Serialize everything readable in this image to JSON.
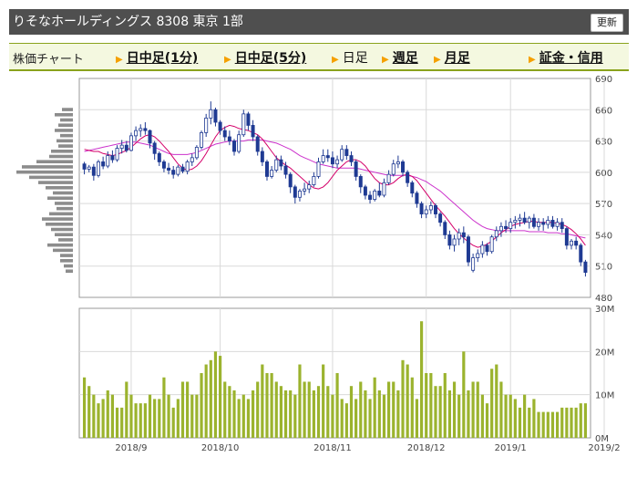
{
  "header": {
    "title": "りそなホールディングス 8308 東京 1部",
    "refresh_label": "更新"
  },
  "tabs": {
    "chart_label": "株価チャート",
    "items": [
      {
        "label": "日中足(1分)",
        "style": "bold"
      },
      {
        "label": "日中足(5分)",
        "style": "bold"
      },
      {
        "label": "日足",
        "style": "plain"
      },
      {
        "label": "週足",
        "style": "bold"
      },
      {
        "label": "月足",
        "style": "bold"
      },
      {
        "label": "証金・信用",
        "style": "bold"
      }
    ]
  },
  "colors": {
    "accent": "#8aa21c",
    "up": "#ffffff",
    "down": "#1f3a93",
    "ma_short": "#d4006a",
    "ma_long": "#cc33cc",
    "volume": "#9bb32e",
    "profile": "#8c8c8c"
  },
  "chart_data": {
    "type": "candlestick",
    "title": "",
    "price_axis": {
      "ylim": [
        480,
        690
      ],
      "ticks": [
        480,
        510,
        540,
        570,
        600,
        630,
        660,
        690
      ]
    },
    "volume_axis": {
      "ylim": [
        0,
        30
      ],
      "ticks": [
        "0M",
        "10M",
        "20M",
        "30M"
      ]
    },
    "x_labels": [
      "2018/9",
      "2018/10",
      "2018/11",
      "2018/12",
      "2019/1",
      "2019/2"
    ],
    "x_label_index": [
      10,
      29,
      53,
      73,
      91,
      111
    ],
    "grid": true,
    "candles": [
      [
        608,
        610,
        598,
        603
      ],
      [
        603,
        607,
        600,
        605
      ],
      [
        605,
        608,
        592,
        597
      ],
      [
        597,
        612,
        595,
        610
      ],
      [
        610,
        615,
        603,
        606
      ],
      [
        606,
        620,
        604,
        616
      ],
      [
        616,
        621,
        609,
        612
      ],
      [
        612,
        626,
        610,
        623
      ],
      [
        623,
        631,
        618,
        626
      ],
      [
        626,
        630,
        619,
        621
      ],
      [
        621,
        638,
        620,
        635
      ],
      [
        635,
        644,
        630,
        640
      ],
      [
        640,
        646,
        634,
        642
      ],
      [
        642,
        648,
        636,
        640
      ],
      [
        640,
        641,
        623,
        628
      ],
      [
        628,
        630,
        612,
        618
      ],
      [
        618,
        620,
        606,
        610
      ],
      [
        610,
        612,
        600,
        604
      ],
      [
        604,
        609,
        598,
        602
      ],
      [
        602,
        606,
        594,
        598
      ],
      [
        598,
        607,
        596,
        605
      ],
      [
        605,
        608,
        599,
        601
      ],
      [
        601,
        612,
        598,
        610
      ],
      [
        610,
        618,
        606,
        614
      ],
      [
        614,
        626,
        612,
        624
      ],
      [
        624,
        640,
        622,
        638
      ],
      [
        638,
        656,
        634,
        652
      ],
      [
        652,
        668,
        646,
        660
      ],
      [
        660,
        662,
        644,
        648
      ],
      [
        648,
        650,
        636,
        640
      ],
      [
        640,
        644,
        630,
        634
      ],
      [
        634,
        640,
        626,
        630
      ],
      [
        630,
        632,
        616,
        620
      ],
      [
        620,
        640,
        618,
        636
      ],
      [
        636,
        660,
        634,
        656
      ],
      [
        656,
        658,
        640,
        645
      ],
      [
        645,
        650,
        630,
        634
      ],
      [
        634,
        636,
        616,
        620
      ],
      [
        620,
        624,
        606,
        610
      ],
      [
        610,
        612,
        592,
        596
      ],
      [
        596,
        606,
        594,
        602
      ],
      [
        602,
        616,
        600,
        612
      ],
      [
        612,
        616,
        602,
        606
      ],
      [
        606,
        610,
        594,
        598
      ],
      [
        598,
        600,
        580,
        586
      ],
      [
        586,
        588,
        570,
        576
      ],
      [
        576,
        584,
        572,
        582
      ],
      [
        582,
        590,
        578,
        584
      ],
      [
        584,
        592,
        580,
        588
      ],
      [
        588,
        600,
        586,
        596
      ],
      [
        596,
        614,
        594,
        610
      ],
      [
        610,
        622,
        608,
        616
      ],
      [
        616,
        622,
        610,
        614
      ],
      [
        614,
        620,
        604,
        608
      ],
      [
        608,
        616,
        604,
        612
      ],
      [
        612,
        626,
        610,
        622
      ],
      [
        622,
        626,
        612,
        616
      ],
      [
        616,
        620,
        606,
        610
      ],
      [
        610,
        612,
        592,
        596
      ],
      [
        596,
        598,
        580,
        586
      ],
      [
        586,
        588,
        574,
        578
      ],
      [
        578,
        582,
        570,
        574
      ],
      [
        574,
        584,
        572,
        582
      ],
      [
        582,
        590,
        576,
        578
      ],
      [
        578,
        594,
        576,
        590
      ],
      [
        590,
        602,
        588,
        598
      ],
      [
        598,
        612,
        596,
        608
      ],
      [
        608,
        616,
        604,
        610
      ],
      [
        610,
        612,
        596,
        600
      ],
      [
        600,
        602,
        586,
        590
      ],
      [
        590,
        592,
        576,
        580
      ],
      [
        580,
        582,
        566,
        570
      ],
      [
        570,
        572,
        556,
        560
      ],
      [
        560,
        568,
        556,
        564
      ],
      [
        564,
        572,
        560,
        568
      ],
      [
        568,
        570,
        556,
        560
      ],
      [
        560,
        562,
        548,
        552
      ],
      [
        552,
        554,
        536,
        540
      ],
      [
        540,
        544,
        526,
        530
      ],
      [
        530,
        540,
        524,
        536
      ],
      [
        536,
        546,
        530,
        542
      ],
      [
        542,
        548,
        532,
        538
      ],
      [
        538,
        540,
        510,
        514
      ],
      [
        506,
        522,
        504,
        518
      ],
      [
        518,
        526,
        514,
        522
      ],
      [
        522,
        534,
        518,
        530
      ],
      [
        530,
        532,
        520,
        524
      ],
      [
        524,
        540,
        522,
        538
      ],
      [
        538,
        548,
        534,
        544
      ],
      [
        544,
        552,
        538,
        548
      ],
      [
        548,
        554,
        542,
        546
      ],
      [
        546,
        556,
        542,
        552
      ],
      [
        552,
        558,
        546,
        554
      ],
      [
        554,
        560,
        548,
        556
      ],
      [
        556,
        562,
        550,
        552
      ],
      [
        552,
        558,
        546,
        556
      ],
      [
        556,
        560,
        546,
        548
      ],
      [
        548,
        556,
        544,
        552
      ],
      [
        552,
        556,
        544,
        550
      ],
      [
        550,
        558,
        546,
        554
      ],
      [
        554,
        558,
        546,
        548
      ],
      [
        548,
        556,
        544,
        552
      ],
      [
        552,
        556,
        542,
        546
      ],
      [
        546,
        548,
        526,
        530
      ],
      [
        530,
        536,
        526,
        534
      ],
      [
        534,
        538,
        526,
        530
      ],
      [
        530,
        532,
        510,
        514
      ],
      [
        514,
        516,
        500,
        504
      ]
    ],
    "ma_short": [
      622,
      621,
      620,
      620,
      618,
      617,
      616,
      617,
      619,
      621,
      624,
      628,
      632,
      635,
      636,
      634,
      630,
      625,
      620,
      614,
      608,
      604,
      602,
      603,
      606,
      611,
      618,
      626,
      634,
      640,
      643,
      645,
      644,
      642,
      641,
      640,
      638,
      636,
      632,
      626,
      620,
      614,
      610,
      607,
      604,
      600,
      596,
      592,
      588,
      585,
      584,
      586,
      590,
      596,
      602,
      606,
      610,
      612,
      612,
      610,
      606,
      600,
      594,
      590,
      588,
      588,
      590,
      594,
      597,
      598,
      596,
      592,
      586,
      580,
      574,
      568,
      563,
      558,
      552,
      546,
      541,
      537,
      533,
      530,
      528,
      529,
      531,
      534,
      538,
      542,
      545,
      548,
      550,
      551,
      552,
      553,
      553,
      552,
      552,
      552,
      552,
      551,
      550,
      548,
      545,
      541,
      536,
      530
    ],
    "ma_long": [
      620,
      621,
      622,
      623,
      624,
      625,
      626,
      627,
      628,
      629,
      629,
      629,
      628,
      627,
      626,
      624,
      622,
      620,
      618,
      617,
      617,
      617,
      617,
      618,
      619,
      621,
      623,
      625,
      627,
      628,
      629,
      630,
      630,
      630,
      630,
      631,
      631,
      631,
      631,
      630,
      629,
      628,
      626,
      624,
      622,
      619,
      616,
      614,
      612,
      610,
      608,
      607,
      606,
      605,
      604,
      604,
      604,
      604,
      604,
      603,
      602,
      601,
      600,
      599,
      598,
      597,
      597,
      597,
      597,
      597,
      596,
      595,
      593,
      591,
      588,
      585,
      582,
      578,
      574,
      570,
      566,
      562,
      558,
      554,
      551,
      548,
      546,
      545,
      544,
      544,
      544,
      544,
      544,
      544,
      544,
      543,
      543,
      543,
      543,
      542,
      542,
      542,
      541,
      541,
      540,
      539,
      538,
      537
    ],
    "volume": [
      14,
      12,
      10,
      8,
      9,
      11,
      10,
      7,
      7,
      13,
      10,
      8,
      8,
      8,
      10,
      9,
      9,
      14,
      10,
      7,
      9,
      13,
      13,
      10,
      10,
      15,
      17,
      18,
      20,
      19,
      13,
      12,
      11,
      9,
      10,
      9,
      11,
      13,
      17,
      15,
      15,
      13,
      12,
      11,
      11,
      10,
      17,
      13,
      13,
      11,
      12,
      17,
      12,
      10,
      15,
      9,
      8,
      12,
      9,
      13,
      11,
      9,
      14,
      11,
      10,
      13,
      13,
      11,
      18,
      17,
      14,
      9,
      27,
      15,
      15,
      12,
      12,
      15,
      11,
      13,
      10,
      20,
      11,
      13,
      13,
      10,
      8,
      16,
      17,
      13,
      10,
      10,
      9,
      7,
      10,
      7,
      9,
      6,
      6,
      6,
      6,
      6,
      7,
      7,
      7,
      7,
      8,
      8
    ],
    "volume_profile": [
      [
        660,
        12
      ],
      [
        655,
        20
      ],
      [
        650,
        14
      ],
      [
        645,
        16
      ],
      [
        640,
        20
      ],
      [
        635,
        14
      ],
      [
        630,
        18
      ],
      [
        625,
        16
      ],
      [
        620,
        24
      ],
      [
        615,
        26
      ],
      [
        610,
        40
      ],
      [
        605,
        56
      ],
      [
        600,
        62
      ],
      [
        595,
        48
      ],
      [
        590,
        38
      ],
      [
        585,
        30
      ],
      [
        580,
        22
      ],
      [
        575,
        28
      ],
      [
        570,
        20
      ],
      [
        565,
        18
      ],
      [
        560,
        26
      ],
      [
        555,
        34
      ],
      [
        550,
        30
      ],
      [
        545,
        24
      ],
      [
        540,
        20
      ],
      [
        535,
        16
      ],
      [
        530,
        28
      ],
      [
        525,
        22
      ],
      [
        520,
        14
      ],
      [
        515,
        14
      ],
      [
        510,
        10
      ],
      [
        505,
        8
      ]
    ]
  }
}
